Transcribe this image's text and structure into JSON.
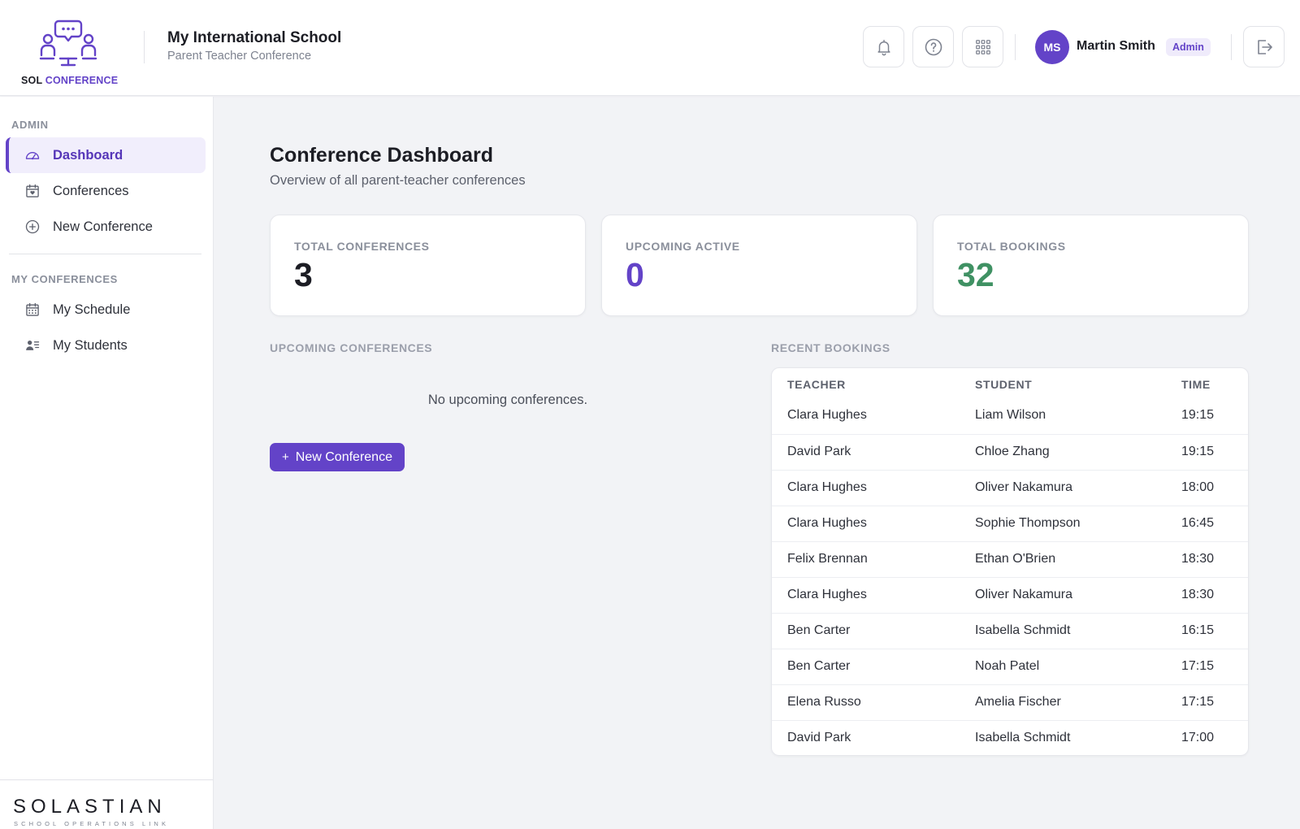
{
  "header": {
    "logo": {
      "sol": "SOL",
      "conference": "CONFERENCE"
    },
    "school_name": "My International School",
    "school_subtitle": "Parent Teacher Conference",
    "icons": [
      "bell-icon",
      "help-icon",
      "apps-grid-icon",
      "logout-icon"
    ],
    "user": {
      "initials": "MS",
      "name": "Martin Smith",
      "role": "Admin"
    }
  },
  "sidebar": {
    "admin_label": "ADMIN",
    "admin_items": [
      {
        "label": "Dashboard",
        "icon": "gauge-icon",
        "active": true
      },
      {
        "label": "Conferences",
        "icon": "calendar-heart-icon",
        "active": false
      },
      {
        "label": "New Conference",
        "icon": "plus-circle-icon",
        "active": false
      }
    ],
    "my_label": "MY CONFERENCES",
    "my_items": [
      {
        "label": "My Schedule",
        "icon": "calendar-grid-icon"
      },
      {
        "label": "My Students",
        "icon": "users-list-icon"
      }
    ],
    "brand": {
      "name": "SOLASTIAN",
      "tagline": "SCHOOL OPERATIONS LINK"
    }
  },
  "main": {
    "title": "Conference Dashboard",
    "subtitle": "Overview of all parent-teacher conferences",
    "stats": [
      {
        "label": "TOTAL CONFERENCES",
        "value": "3",
        "color": "#1c1d24"
      },
      {
        "label": "UPCOMING ACTIVE",
        "value": "0",
        "color": "#6343c8"
      },
      {
        "label": "TOTAL BOOKINGS",
        "value": "32",
        "color": "#3f9163"
      }
    ],
    "upcoming": {
      "title": "UPCOMING CONFERENCES",
      "empty_message": "No upcoming conferences.",
      "new_button": "New Conference"
    },
    "recent": {
      "title": "RECENT BOOKINGS",
      "columns": [
        "TEACHER",
        "STUDENT",
        "TIME"
      ],
      "rows": [
        [
          "Clara Hughes",
          "Liam Wilson",
          "19:15"
        ],
        [
          "David Park",
          "Chloe Zhang",
          "19:15"
        ],
        [
          "Clara Hughes",
          "Oliver Nakamura",
          "18:00"
        ],
        [
          "Clara Hughes",
          "Sophie Thompson",
          "16:45"
        ],
        [
          "Felix Brennan",
          "Ethan O'Brien",
          "18:30"
        ],
        [
          "Clara Hughes",
          "Oliver Nakamura",
          "18:30"
        ],
        [
          "Ben Carter",
          "Isabella Schmidt",
          "16:15"
        ],
        [
          "Ben Carter",
          "Noah Patel",
          "17:15"
        ],
        [
          "Elena Russo",
          "Amelia Fischer",
          "17:15"
        ],
        [
          "David Park",
          "Isabella Schmidt",
          "17:00"
        ]
      ]
    }
  },
  "colors": {
    "accent": "#6343c8",
    "success": "#3f9163"
  }
}
